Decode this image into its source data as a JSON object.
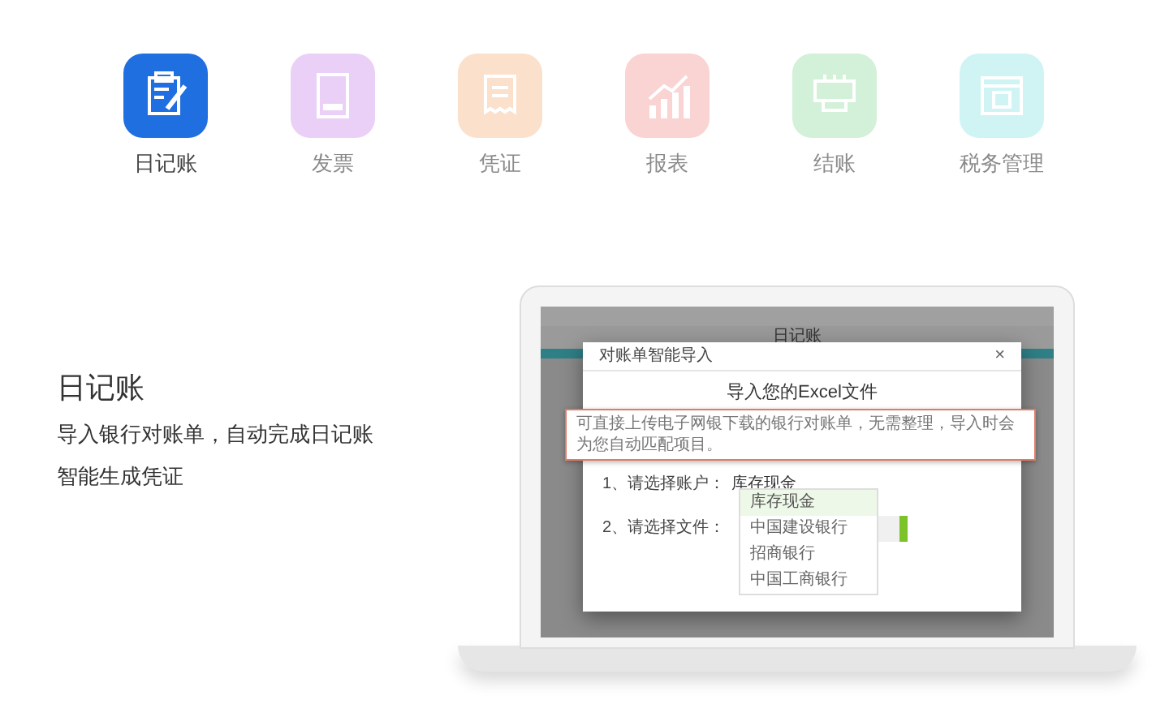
{
  "tabs": [
    {
      "label": "日记账",
      "selected": true,
      "color": "#1f6fe0"
    },
    {
      "label": "发票",
      "selected": false,
      "color": "#ead0f7"
    },
    {
      "label": "凭证",
      "selected": false,
      "color": "#fbe0cc"
    },
    {
      "label": "报表",
      "selected": false,
      "color": "#fad3d3"
    },
    {
      "label": "结账",
      "selected": false,
      "color": "#d3f0d8"
    },
    {
      "label": "税务管理",
      "selected": false,
      "color": "#cff4f3"
    }
  ],
  "feature": {
    "title": "日记账",
    "lines": [
      "导入银行对账单，自动完成日记账",
      "智能生成凭证"
    ]
  },
  "laptop_screen": {
    "app_title": "日记账",
    "dialog": {
      "title": "对账单智能导入",
      "close": "×",
      "heading": "导入您的Excel文件",
      "tooltip": "可直接上传电子网银下载的银行对账单，无需整理，导入时会为您自动匹配项目。",
      "rows": [
        {
          "label": "1、请选择账户：",
          "value": "库存现金"
        },
        {
          "label": "2、请选择文件："
        }
      ],
      "dropdown": [
        {
          "label": "库存现金",
          "selected": true
        },
        {
          "label": "中国建设银行",
          "selected": false
        },
        {
          "label": "招商银行",
          "selected": false
        },
        {
          "label": "中国工商银行",
          "selected": false
        }
      ]
    }
  }
}
